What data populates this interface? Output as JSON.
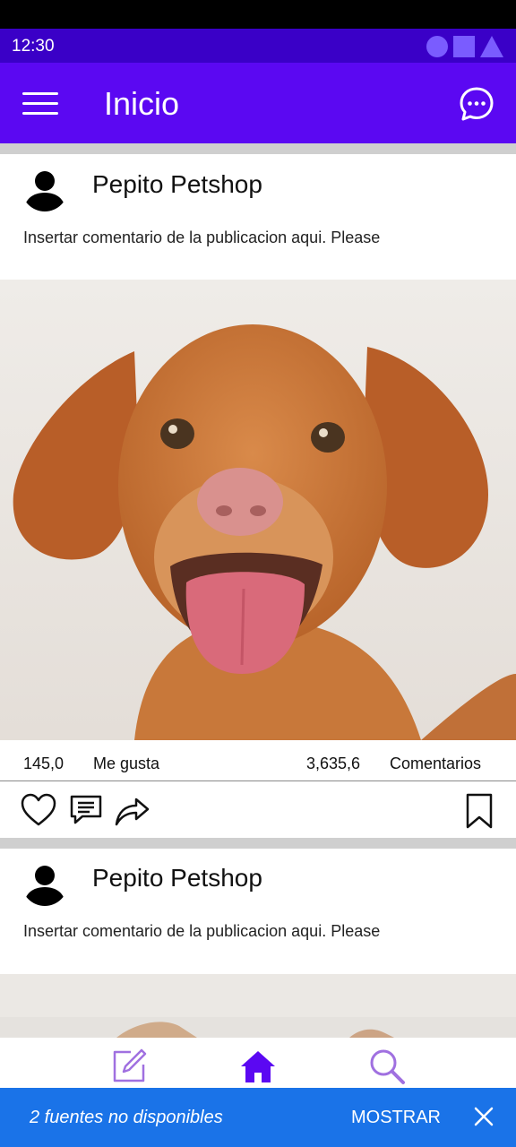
{
  "status_bar": {
    "time": "12:30"
  },
  "app_bar": {
    "title": "Inicio"
  },
  "posts": [
    {
      "author": "Pepito Petshop",
      "caption": "Insertar comentario de la publicacion aqui. Please",
      "likes_count": "145,0",
      "likes_label": "Me gusta",
      "comments_count": "3,635,6",
      "comments_label": "Comentarios",
      "image": "dog-photo"
    },
    {
      "author": "Pepito Petshop",
      "caption": "Insertar comentario de la publicacion aqui. Please",
      "image": "dog-photo"
    }
  ],
  "bottom_nav": {
    "items": [
      {
        "icon": "edit-icon"
      },
      {
        "icon": "home-icon",
        "active": true
      },
      {
        "icon": "search-icon"
      }
    ]
  },
  "snackbar": {
    "message": "2 fuentes no disponibles",
    "action": "MOSTRAR"
  },
  "colors": {
    "status_bar": "#3a00c7",
    "app_bar": "#5b08f2",
    "nav_active": "#5b08f2",
    "nav_inactive": "#a070e0",
    "snackbar": "#1a73e8"
  }
}
